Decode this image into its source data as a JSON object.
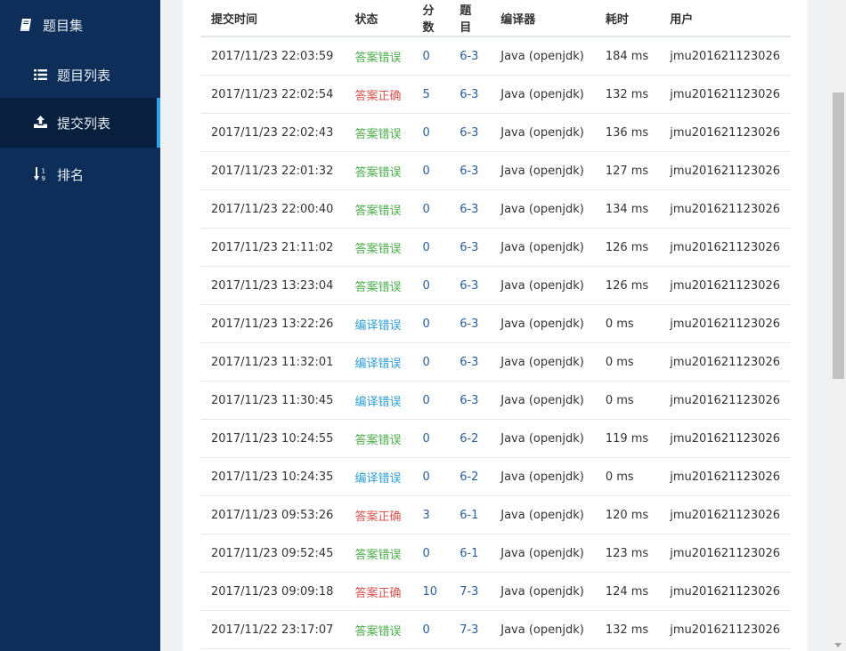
{
  "sidebar": {
    "group_label": "题目集",
    "items": [
      {
        "label": "题目列表",
        "icon": "list-icon",
        "active": false
      },
      {
        "label": "提交列表",
        "icon": "upload-icon",
        "active": true
      },
      {
        "label": "排名",
        "icon": "sort-numeric-icon",
        "active": false
      }
    ]
  },
  "colors": {
    "sidebar_bg": "#0d2e58",
    "active_bg": "#08203e",
    "active_accent": "#2fa3e6",
    "status_answer_wrong": "#4cae4c",
    "status_answer_correct": "#d9534f",
    "status_compile_error": "#2f9fd7",
    "link": "#2a5d9a"
  },
  "table": {
    "headers": [
      "提交时间",
      "状态",
      "分数",
      "题目",
      "编译器",
      "耗时",
      "用户"
    ],
    "rows": [
      {
        "time": "2017/11/23 22:03:59",
        "status": "答案错误",
        "status_type": "wrong",
        "score": "0",
        "problem": "6-3",
        "compiler": "Java (openjdk)",
        "cost": "184 ms",
        "user": "jmu201621123026"
      },
      {
        "time": "2017/11/23 22:02:54",
        "status": "答案正确",
        "status_type": "right",
        "score": "5",
        "problem": "6-3",
        "compiler": "Java (openjdk)",
        "cost": "132 ms",
        "user": "jmu201621123026"
      },
      {
        "time": "2017/11/23 22:02:43",
        "status": "答案错误",
        "status_type": "wrong",
        "score": "0",
        "problem": "6-3",
        "compiler": "Java (openjdk)",
        "cost": "136 ms",
        "user": "jmu201621123026"
      },
      {
        "time": "2017/11/23 22:01:32",
        "status": "答案错误",
        "status_type": "wrong",
        "score": "0",
        "problem": "6-3",
        "compiler": "Java (openjdk)",
        "cost": "127 ms",
        "user": "jmu201621123026"
      },
      {
        "time": "2017/11/23 22:00:40",
        "status": "答案错误",
        "status_type": "wrong",
        "score": "0",
        "problem": "6-3",
        "compiler": "Java (openjdk)",
        "cost": "134 ms",
        "user": "jmu201621123026"
      },
      {
        "time": "2017/11/23 21:11:02",
        "status": "答案错误",
        "status_type": "wrong",
        "score": "0",
        "problem": "6-3",
        "compiler": "Java (openjdk)",
        "cost": "126 ms",
        "user": "jmu201621123026"
      },
      {
        "time": "2017/11/23 13:23:04",
        "status": "答案错误",
        "status_type": "wrong",
        "score": "0",
        "problem": "6-3",
        "compiler": "Java (openjdk)",
        "cost": "126 ms",
        "user": "jmu201621123026"
      },
      {
        "time": "2017/11/23 13:22:26",
        "status": "编译错误",
        "status_type": "compile",
        "score": "0",
        "problem": "6-3",
        "compiler": "Java (openjdk)",
        "cost": "0 ms",
        "user": "jmu201621123026"
      },
      {
        "time": "2017/11/23 11:32:01",
        "status": "编译错误",
        "status_type": "compile",
        "score": "0",
        "problem": "6-3",
        "compiler": "Java (openjdk)",
        "cost": "0 ms",
        "user": "jmu201621123026"
      },
      {
        "time": "2017/11/23 11:30:45",
        "status": "编译错误",
        "status_type": "compile",
        "score": "0",
        "problem": "6-3",
        "compiler": "Java (openjdk)",
        "cost": "0 ms",
        "user": "jmu201621123026"
      },
      {
        "time": "2017/11/23 10:24:55",
        "status": "答案错误",
        "status_type": "wrong",
        "score": "0",
        "problem": "6-2",
        "compiler": "Java (openjdk)",
        "cost": "119 ms",
        "user": "jmu201621123026"
      },
      {
        "time": "2017/11/23 10:24:35",
        "status": "编译错误",
        "status_type": "compile",
        "score": "0",
        "problem": "6-2",
        "compiler": "Java (openjdk)",
        "cost": "0 ms",
        "user": "jmu201621123026"
      },
      {
        "time": "2017/11/23 09:53:26",
        "status": "答案正确",
        "status_type": "right",
        "score": "3",
        "problem": "6-1",
        "compiler": "Java (openjdk)",
        "cost": "120 ms",
        "user": "jmu201621123026"
      },
      {
        "time": "2017/11/23 09:52:45",
        "status": "答案错误",
        "status_type": "wrong",
        "score": "0",
        "problem": "6-1",
        "compiler": "Java (openjdk)",
        "cost": "123 ms",
        "user": "jmu201621123026"
      },
      {
        "time": "2017/11/23 09:09:18",
        "status": "答案正确",
        "status_type": "right",
        "score": "10",
        "problem": "7-3",
        "compiler": "Java (openjdk)",
        "cost": "124 ms",
        "user": "jmu201621123026"
      },
      {
        "time": "2017/11/22 23:17:07",
        "status": "答案错误",
        "status_type": "wrong",
        "score": "0",
        "problem": "7-3",
        "compiler": "Java (openjdk)",
        "cost": "132 ms",
        "user": "jmu201621123026"
      }
    ]
  }
}
